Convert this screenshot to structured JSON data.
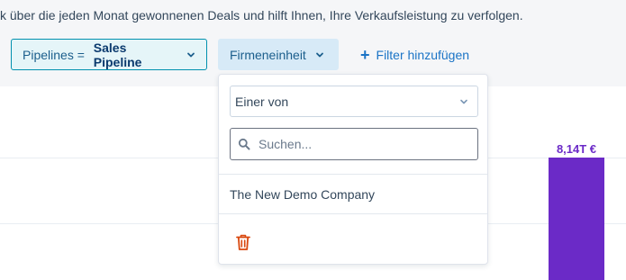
{
  "header": {
    "description": "k über die jeden Monat gewonnenen Deals und hilft Ihnen, Ihre Verkaufsleistung zu verfolgen."
  },
  "filters": {
    "pipelines_prefix": "Pipelines = ",
    "pipelines_value": "Sales Pipeline",
    "company_label": "Firmeneinheit",
    "add_filter_label": "Filter hinzufügen"
  },
  "dropdown": {
    "operator": "Einer von",
    "search_placeholder": "Suchen...",
    "options": [
      "The New Demo Company"
    ]
  },
  "chart_data": {
    "type": "bar",
    "values": [
      8140
    ],
    "labels": [
      "8,14T €"
    ]
  },
  "colors": {
    "accent": "#0091ae",
    "bar": "#6b2ac7",
    "link": "#1b74c6",
    "trash": "#d9480f"
  }
}
